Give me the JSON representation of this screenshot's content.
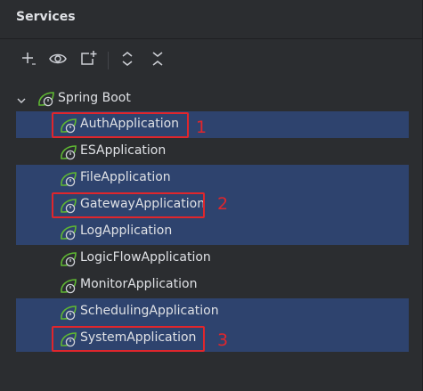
{
  "panel": {
    "title": "Services"
  },
  "toolbar": {
    "buttons": [
      {
        "icon": "add-icon"
      },
      {
        "icon": "eye-icon"
      },
      {
        "icon": "new-tab-icon"
      },
      {
        "icon": "expand-all-icon"
      },
      {
        "icon": "collapse-all-icon"
      }
    ]
  },
  "tree": {
    "root": {
      "label": "Spring Boot",
      "icon": "spring-boot-icon",
      "expanded": true
    },
    "items": [
      {
        "label": "AuthApplication",
        "selected": true,
        "annotation": "1"
      },
      {
        "label": "ESApplication",
        "selected": false,
        "annotation": ""
      },
      {
        "label": "FileApplication",
        "selected": true,
        "annotation": ""
      },
      {
        "label": "GatewayApplication",
        "selected": true,
        "annotation": "2"
      },
      {
        "label": "LogApplication",
        "selected": true,
        "annotation": ""
      },
      {
        "label": "LogicFlowApplication",
        "selected": false,
        "annotation": ""
      },
      {
        "label": "MonitorApplication",
        "selected": false,
        "annotation": ""
      },
      {
        "label": "SchedulingApplication",
        "selected": true,
        "annotation": ""
      },
      {
        "label": "SystemApplication",
        "selected": true,
        "annotation": "3"
      }
    ]
  },
  "colors": {
    "panel_bg": "#2b2d30",
    "selection_bg": "#2e436e",
    "annotation_red": "#e0262c",
    "spring_green": "#5fb832",
    "text": "#dfe1e5"
  },
  "annotations": {
    "one": "1",
    "two": "2",
    "three": "3"
  }
}
